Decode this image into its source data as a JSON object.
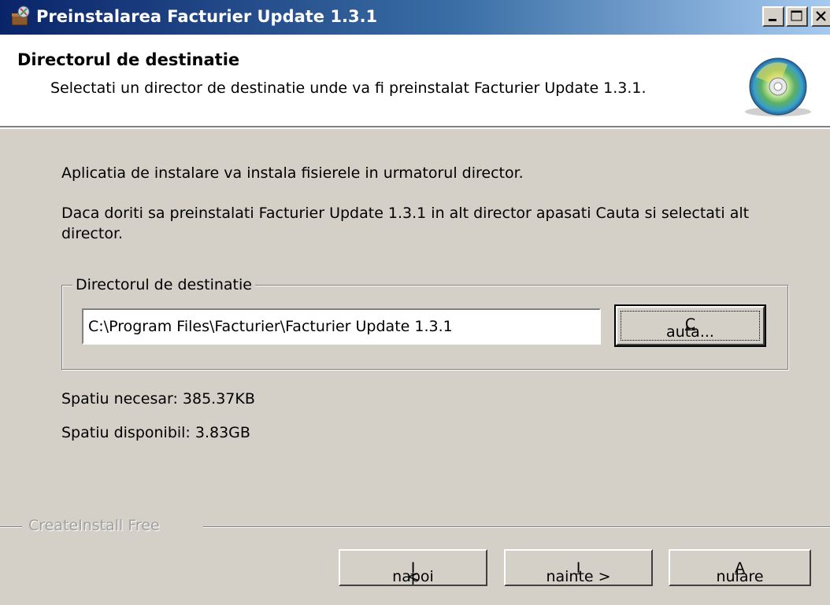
{
  "window": {
    "title": "Preinstalarea Facturier Update 1.3.1"
  },
  "header": {
    "title": "Directorul de destinatie",
    "description": "Selectati un director de destinatie unde va fi preinstalat Facturier Update 1.3.1.",
    "icon": "cd-disc-icon"
  },
  "body": {
    "intro": "Aplicatia de instalare va instala fisierele in urmatorul director.",
    "instructions": "Daca doriti sa preinstalati Facturier Update 1.3.1 in alt director apasati Cauta si selectati alt director."
  },
  "destination": {
    "group_label": "Directorul de destinatie",
    "path": "C:\\Program Files\\Facturier\\Facturier Update 1.3.1",
    "browse_label": "Cauta...",
    "browse_mnemonic": "C",
    "browse_rest": "auta..."
  },
  "space": {
    "required": "Spatiu necesar: 385.37KB",
    "available": "Spatiu disponibil: 3.83GB"
  },
  "brand": "CreateInstall Free",
  "buttons": {
    "back_prefix": "< ",
    "back_mnemonic": "I",
    "back_rest": "napoi",
    "next_mnemonic": "I",
    "next_rest": "nainte >",
    "cancel_mnemonic": "A",
    "cancel_rest": "nulare"
  },
  "colors": {
    "titlebar_start": "#0a246a",
    "titlebar_end": "#a6caf0",
    "face": "#d4d0c8"
  }
}
